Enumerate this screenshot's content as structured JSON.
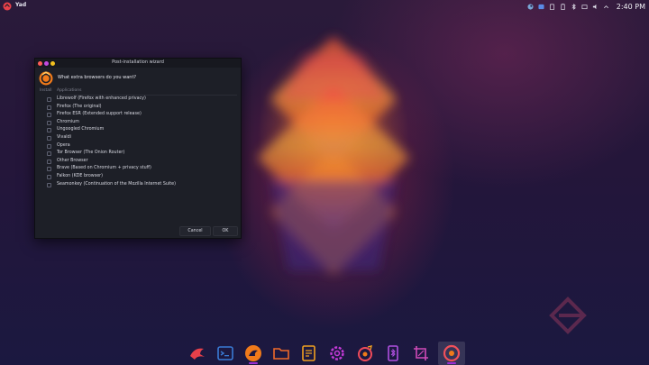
{
  "top_panel": {
    "app_name": "Yad",
    "clock": "2:40 PM",
    "tray_icons": [
      "steam-icon",
      "discord-icon",
      "clipboard-icon",
      "battery-icon",
      "bluetooth-icon",
      "network-icon",
      "volume-icon",
      "chevron-up-icon"
    ]
  },
  "dialog": {
    "title": "Post-installation wizard",
    "question": "What extra browsers do you want?",
    "columns": {
      "install": "Install",
      "applications": "Applications"
    },
    "items": [
      {
        "label": "Librewolf (Firefox with enhanced privacy)",
        "checked": false
      },
      {
        "label": "Firefox (The original)",
        "checked": false
      },
      {
        "label": "Firefox ESR (Extended support release)",
        "checked": false
      },
      {
        "label": "Chromium",
        "checked": false
      },
      {
        "label": "Ungoogled Chromium",
        "checked": false
      },
      {
        "label": "Vivaldi",
        "checked": false
      },
      {
        "label": "Opera",
        "checked": false
      },
      {
        "label": "Tor Browser (The Onion Router)",
        "checked": false
      },
      {
        "label": "Other Browser",
        "checked": false
      },
      {
        "label": "Brave (Based on Chromium + privacy stuff)",
        "checked": false
      },
      {
        "label": "Falkon (KDE browser)",
        "checked": false
      },
      {
        "label": "Seamonkey (Continuation of the Mozilla Internet Suite)",
        "checked": false
      }
    ],
    "buttons": {
      "cancel": "Cancel",
      "ok": "OK"
    }
  },
  "dock": {
    "items": [
      {
        "name": "garuda-launcher-icon",
        "color": "#e8404a"
      },
      {
        "name": "terminal-icon",
        "color": "#3a7bd5"
      },
      {
        "name": "firedragon-browser-icon",
        "color": "#f07a1a"
      },
      {
        "name": "file-manager-icon",
        "color": "#f06a2a"
      },
      {
        "name": "text-editor-icon",
        "color": "#f0a020"
      },
      {
        "name": "settings-gear-icon",
        "color": "#c43ad8"
      },
      {
        "name": "garuda-assistant-icon",
        "color": "#f04a5a"
      },
      {
        "name": "phone-connect-icon",
        "color": "#b050e0"
      },
      {
        "name": "screenshot-crop-icon",
        "color": "#d04ab8"
      },
      {
        "name": "yad-icon",
        "color": "#f0505a"
      }
    ],
    "accent": "#9b2fd6"
  }
}
